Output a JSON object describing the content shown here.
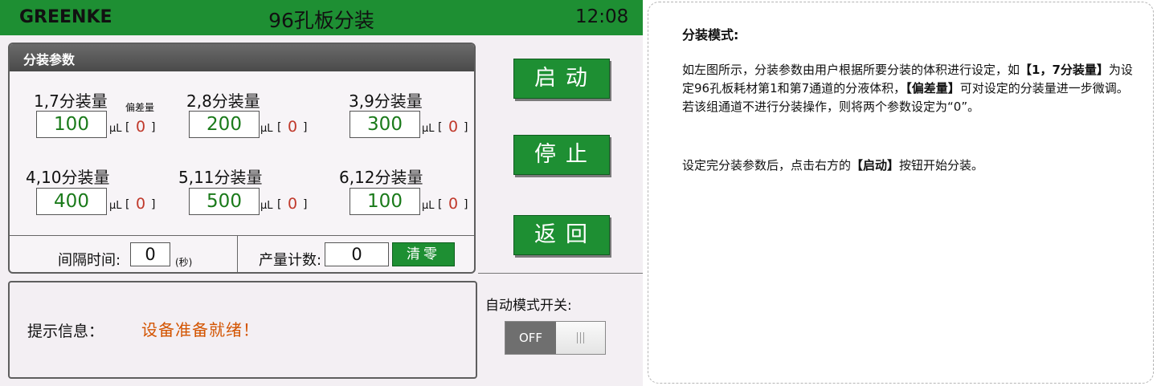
{
  "topbar": {
    "brand": "GREENKE",
    "title": "96孔板分装",
    "clock": "12:08"
  },
  "panel": {
    "header": "分装参数",
    "deviation_label": "偏差量",
    "unit": "μL",
    "bracket_open": "[",
    "bracket_close": "]",
    "channels": [
      {
        "label": "1,7分装量",
        "value": "100",
        "deviation": "0"
      },
      {
        "label": "2,8分装量",
        "value": "200",
        "deviation": "0"
      },
      {
        "label": "3,9分装量",
        "value": "300",
        "deviation": "0"
      },
      {
        "label": "4,10分装量",
        "value": "400",
        "deviation": "0"
      },
      {
        "label": "5,11分装量",
        "value": "500",
        "deviation": "0"
      },
      {
        "label": "6,12分装量",
        "value": "100",
        "deviation": "0"
      }
    ],
    "interval_label": "间隔时间:",
    "interval_value": "0",
    "interval_unit": "(秒)",
    "count_label": "产量计数:",
    "count_value": "0",
    "clear_label": "清零"
  },
  "buttons": {
    "start": "启动",
    "stop": "停止",
    "back": "返回"
  },
  "message": {
    "label": "提示信息：",
    "text": "设备准备就绪！"
  },
  "auto_mode": {
    "label": "自动模式开关:",
    "state": "OFF"
  },
  "colors": {
    "green": "#1e8f33",
    "value_green": "#1a7a1a",
    "deviation_red": "#c0392b",
    "message_orange": "#d35400"
  },
  "instructions": {
    "heading": "分装模式:",
    "p1_a": "如左图所示，分装参数由用户根据所要分装的体积进行设定，如",
    "p1_b": "【1，7分装量】",
    "p1_c": "为设定96孔板耗材第1和第7通道的分液体积，",
    "p1_d": "【偏差量】",
    "p1_e": "可对设定的分装量进一步微调。若该组通道不进行分装操作，则将两个参数设定为“0”。",
    "p2_a": "设定完分装参数后，点击右方的",
    "p2_b": "【启动】",
    "p2_c": "按钮开始分装。"
  }
}
